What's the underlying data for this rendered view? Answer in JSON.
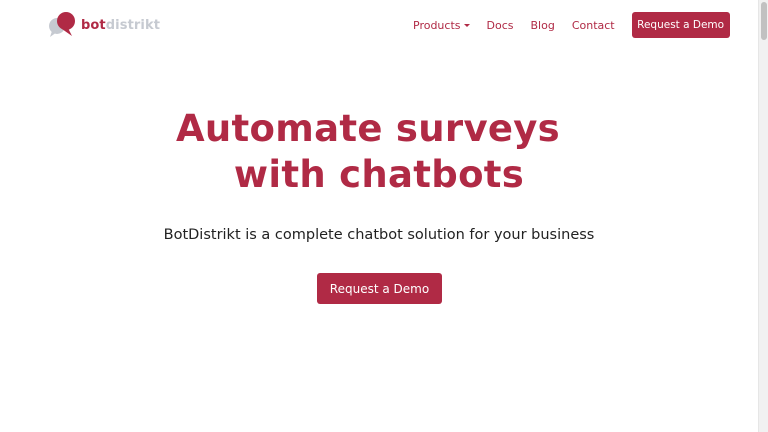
{
  "brand": {
    "name_part1": "bot",
    "name_part2": "distrikt",
    "primary_color": "#b02a45",
    "secondary_color": "#c6cad1"
  },
  "nav": {
    "products": "Products",
    "docs": "Docs",
    "blog": "Blog",
    "contact": "Contact",
    "cta": "Request a Demo"
  },
  "hero": {
    "title_line1": "Automate surveys",
    "title_line2": "with chatbots",
    "subtitle": "BotDistrikt is a complete chatbot solution for your business",
    "cta": "Request a Demo"
  }
}
